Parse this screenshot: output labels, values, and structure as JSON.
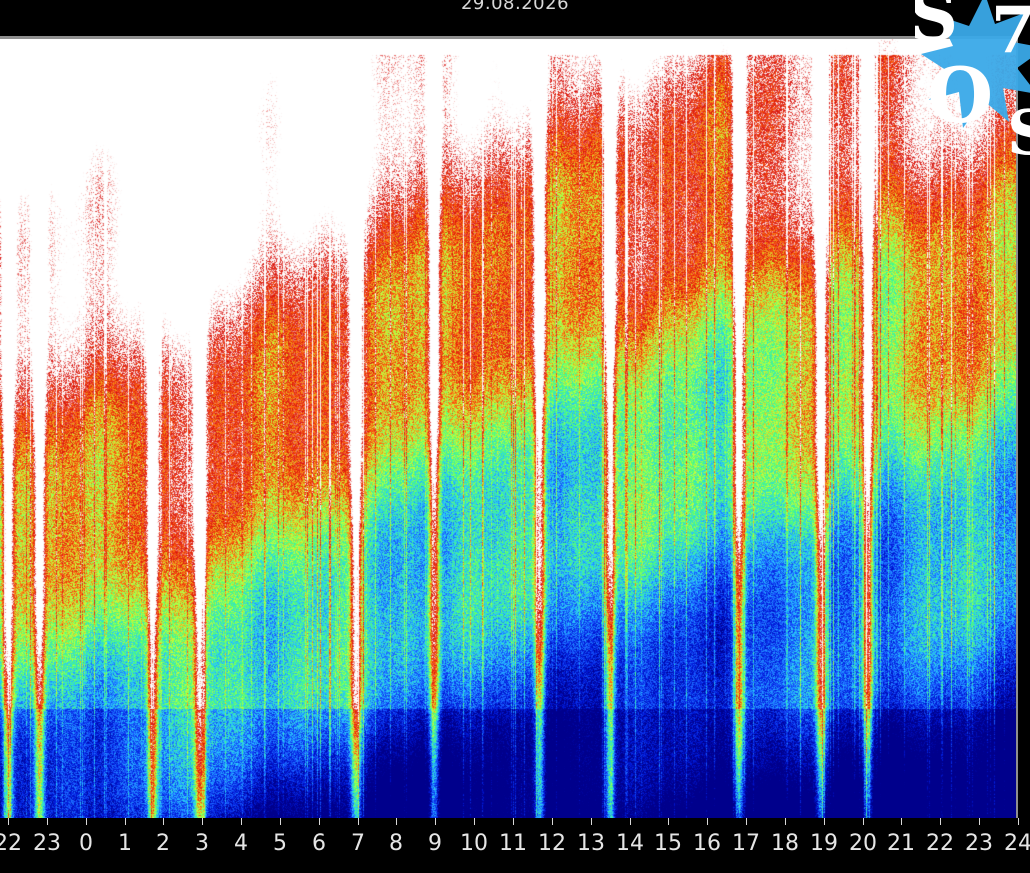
{
  "chart_data": {
    "type": "heatmap",
    "title": "29.08.2026",
    "x_tick_labels": [
      "22",
      "23",
      "0",
      "1",
      "2",
      "3",
      "4",
      "5",
      "6",
      "7",
      "8",
      "9",
      "10",
      "11",
      "12",
      "13",
      "14",
      "15",
      "16",
      "17",
      "18",
      "19",
      "20",
      "21",
      "22",
      "23",
      "24"
    ],
    "x_hours_range": [
      22,
      48
    ],
    "colorscale": [
      "#00008c",
      "#0018d8",
      "#1a5cff",
      "#28c8ff",
      "#4cff7a",
      "#c8ff3a",
      "#ff6a10",
      "#d8100c",
      "#ffffff"
    ],
    "bright_bands_hours": [
      22.2,
      23.0,
      25.9,
      27.1,
      31.1,
      33.1,
      35.8,
      37.6,
      40.9,
      43.0,
      44.2
    ]
  },
  "logo": {
    "line1": "S 7",
    "line2": "O S",
    "colors": [
      "#3aa9e8",
      "#ffffff"
    ]
  }
}
